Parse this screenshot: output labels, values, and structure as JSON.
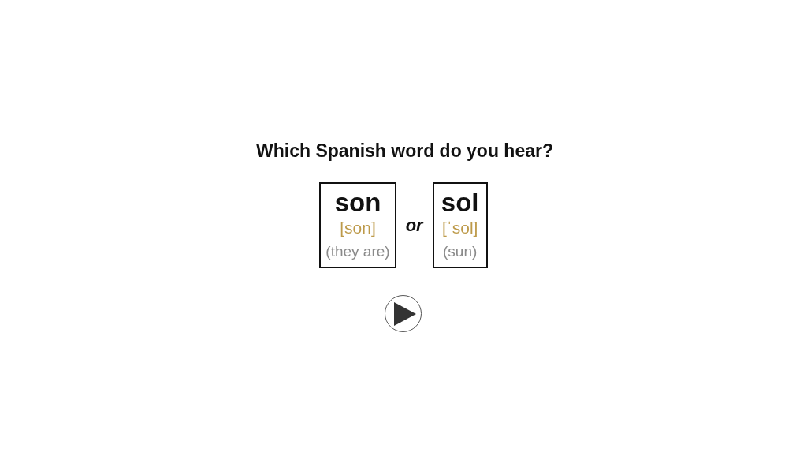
{
  "question": "Which Spanish word do you hear?",
  "options": [
    {
      "word": "son",
      "pronunciation": "[son]",
      "meaning": "(they are)"
    },
    {
      "word": "sol",
      "pronunciation": "[ˈsol]",
      "meaning": "(sun)"
    }
  ],
  "separator": "or"
}
